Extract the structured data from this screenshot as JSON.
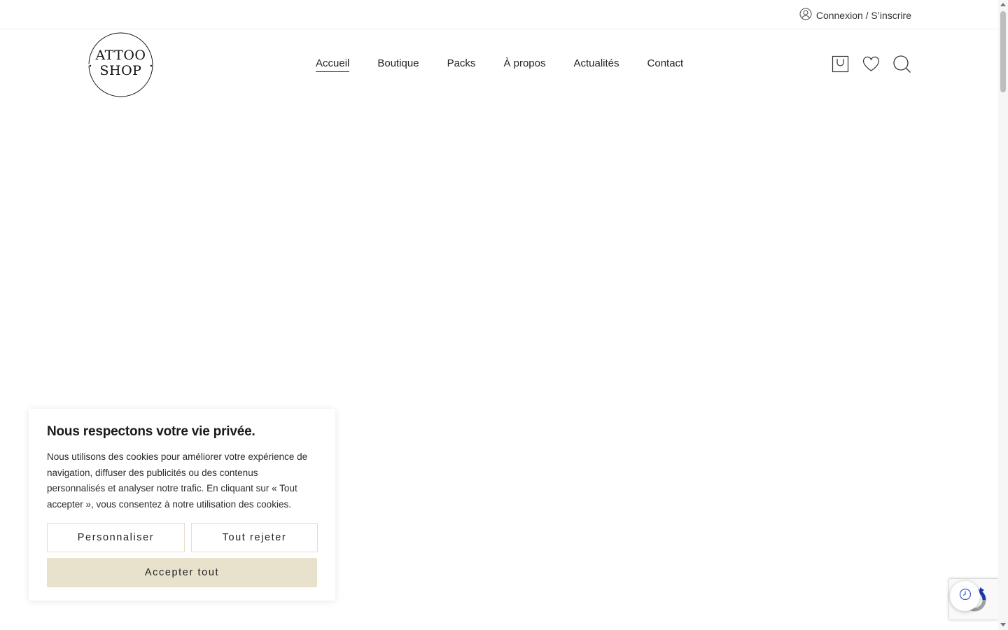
{
  "topbar": {
    "account_label": "Connexion / S’inscrire",
    "account_icon": "user-icon"
  },
  "header": {
    "logo": {
      "line1": "ATTOO",
      "line2": "SHOP"
    },
    "nav": [
      {
        "label": "Accueil",
        "active": true
      },
      {
        "label": "Boutique",
        "active": false
      },
      {
        "label": "Packs",
        "active": false
      },
      {
        "label": "À propos",
        "active": false
      },
      {
        "label": "Actualités",
        "active": false
      },
      {
        "label": "Contact",
        "active": false
      }
    ],
    "icons": [
      "cart-icon",
      "heart-icon",
      "search-icon"
    ]
  },
  "cookie_banner": {
    "title": "Nous respectons votre vie privée.",
    "text": "Nous utilisons des cookies pour améliorer votre expérience de navigation, diffuser des publicités ou des contenus personnalisés et analyser notre trafic. En cliquant sur « Tout accepter », vous consentez à notre utilisation des cookies.",
    "buttons": {
      "customize": "Personnaliser",
      "reject": "Tout rejeter",
      "accept": "Accepter tout"
    }
  },
  "colors": {
    "accent": "#e8e2cc",
    "text": "#222222",
    "border": "#e6e0c6"
  },
  "widgets": {
    "recaptcha_icon": "recaptcha-icon",
    "history_icon": "clock-icon"
  }
}
